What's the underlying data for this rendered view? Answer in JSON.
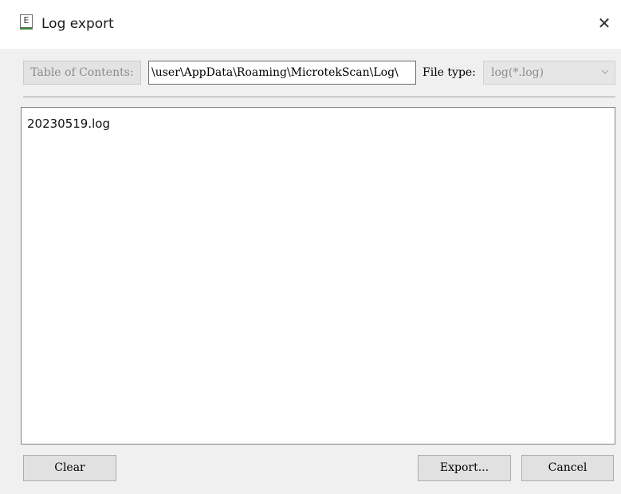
{
  "window": {
    "title": "Log export",
    "app_icon_letter": "E",
    "close_glyph": "✕"
  },
  "toolbar": {
    "toc_label": "Table of Contents:",
    "path_value": "\\user\\AppData\\Roaming\\MicrotekScan\\Log\\",
    "file_type_label": "File type:",
    "file_type_selected": "log(*.log)"
  },
  "file_list": {
    "items": [
      "20230519.log"
    ]
  },
  "buttons": {
    "clear": "Clear",
    "export": "Export...",
    "cancel": "Cancel"
  },
  "icons": {
    "app": "app-icon",
    "close": "close-icon",
    "dropdown": "chevron-down-icon"
  }
}
